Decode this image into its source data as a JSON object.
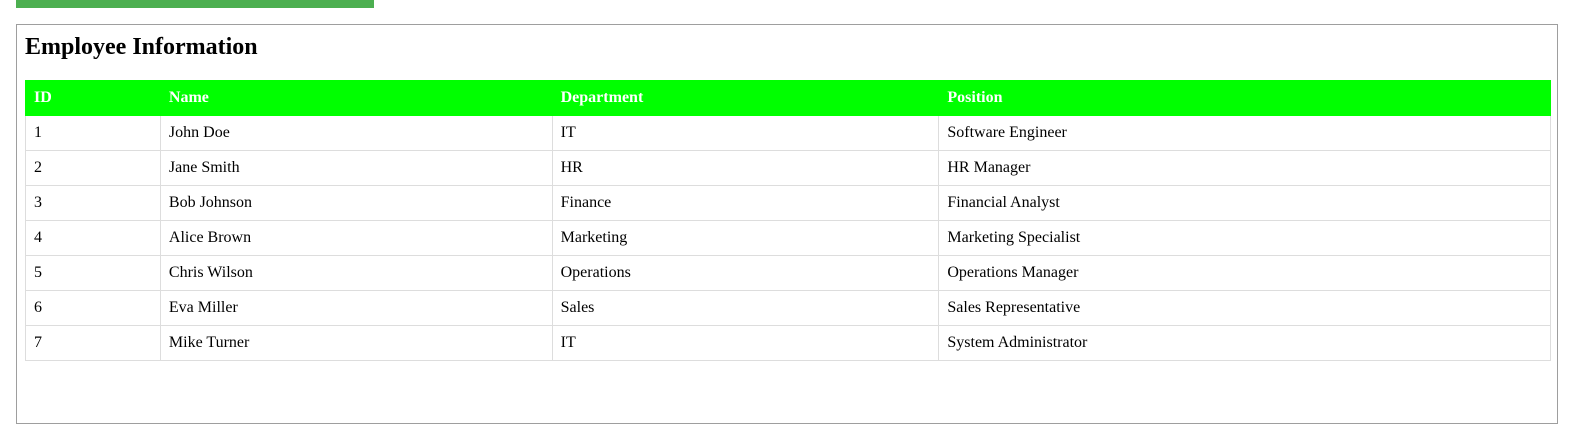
{
  "page": {
    "title": "Employee Information"
  },
  "colors": {
    "accent_bar": "#4caf50",
    "header_bg": "#00ff00",
    "header_text": "#ffffff",
    "border": "#dddddd"
  },
  "table": {
    "headers": [
      "ID",
      "Name",
      "Department",
      "Position"
    ],
    "rows": [
      [
        "1",
        "John Doe",
        "IT",
        "Software Engineer"
      ],
      [
        "2",
        "Jane Smith",
        "HR",
        "HR Manager"
      ],
      [
        "3",
        "Bob Johnson",
        "Finance",
        "Financial Analyst"
      ],
      [
        "4",
        "Alice Brown",
        "Marketing",
        "Marketing Specialist"
      ],
      [
        "5",
        "Chris Wilson",
        "Operations",
        "Operations Manager"
      ],
      [
        "6",
        "Eva Miller",
        "Sales",
        "Sales Representative"
      ],
      [
        "7",
        "Mike Turner",
        "IT",
        "System Administrator"
      ]
    ]
  }
}
